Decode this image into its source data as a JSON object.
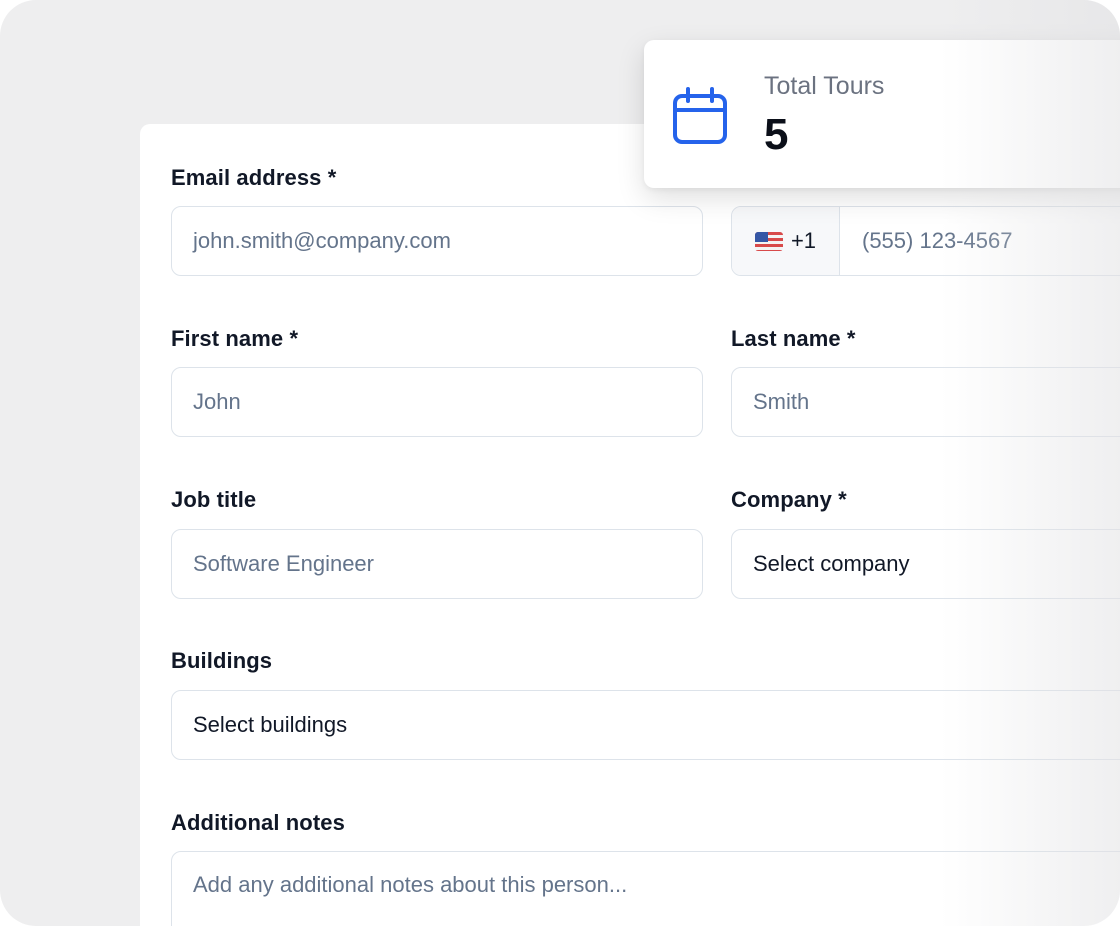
{
  "stat_card": {
    "title": "Total Tours",
    "value": "5",
    "icon": "calendar-icon",
    "accent_color": "#2563eb"
  },
  "form": {
    "email": {
      "label": "Email address *",
      "placeholder": "john.smith@company.com"
    },
    "phone": {
      "country_flag": "us-flag-icon",
      "country_code": "+1",
      "placeholder": "(555) 123-4567"
    },
    "first_name": {
      "label": "First name *",
      "placeholder": "John"
    },
    "last_name": {
      "label": "Last name *",
      "placeholder": "Smith"
    },
    "job_title": {
      "label": "Job title",
      "placeholder": "Software Engineer"
    },
    "company": {
      "label": "Company *",
      "value": "Select company"
    },
    "buildings": {
      "label": "Buildings",
      "value": "Select buildings"
    },
    "notes": {
      "label": "Additional notes",
      "placeholder": "Add any additional notes about this person..."
    }
  }
}
